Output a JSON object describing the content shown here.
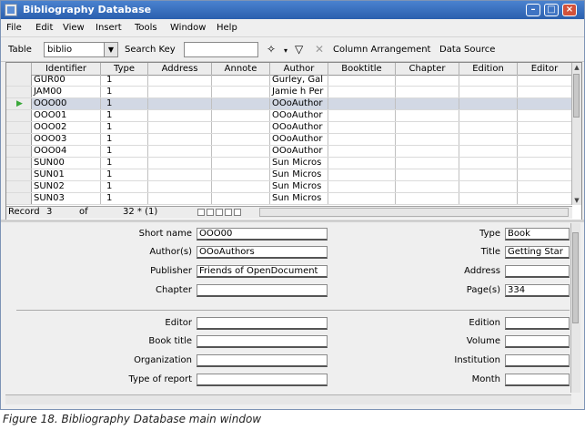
{
  "window": {
    "title": "Bibliography Database",
    "buttons": {
      "minimize": "–",
      "maximize": "□",
      "close": "×"
    }
  },
  "menu": [
    "File",
    "Edit",
    "View",
    "Insert",
    "Tools",
    "Window",
    "Help"
  ],
  "toolbar": {
    "table_label": "Table",
    "table_value": "biblio",
    "search_label": "Search Key",
    "search_value": "",
    "column_arrangement": "Column Arrangement",
    "data_source": "Data Source"
  },
  "table": {
    "columns": [
      "Identifier",
      "Type",
      "Address",
      "Annote",
      "Author",
      "Booktitle",
      "Chapter",
      "Edition",
      "Editor"
    ],
    "rows": [
      {
        "id": "GUR00",
        "type": "1",
        "author": "Gurley, Gal"
      },
      {
        "id": "JAM00",
        "type": "1",
        "author": "Jamie h Per"
      },
      {
        "id": "OOO00",
        "type": "1",
        "author": "OOoAuthor"
      },
      {
        "id": "OOO01",
        "type": "1",
        "author": "OOoAuthor"
      },
      {
        "id": "OOO02",
        "type": "1",
        "author": "OOoAuthor"
      },
      {
        "id": "OOO03",
        "type": "1",
        "author": "OOoAuthor"
      },
      {
        "id": "OOO04",
        "type": "1",
        "author": "OOoAuthor"
      },
      {
        "id": "SUN00",
        "type": "1",
        "author": "Sun Micros"
      },
      {
        "id": "SUN01",
        "type": "1",
        "author": "Sun Micros"
      },
      {
        "id": "SUN02",
        "type": "1",
        "author": "Sun Micros"
      },
      {
        "id": "SUN03",
        "type": "1",
        "author": "Sun Micros"
      }
    ],
    "selected_index": 2,
    "record_label": "Record",
    "record_number": "3",
    "of_label": "of",
    "record_total": "32 * (1)"
  },
  "form": {
    "left": [
      {
        "label": "Short name",
        "value": "OOO00"
      },
      {
        "label": "Author(s)",
        "value": "OOoAuthors"
      },
      {
        "label": "Publisher",
        "value": "Friends of OpenDocument"
      },
      {
        "label": "Chapter",
        "value": ""
      },
      {
        "label": "Editor",
        "value": ""
      },
      {
        "label": "Book title",
        "value": ""
      },
      {
        "label": "Organization",
        "value": ""
      },
      {
        "label": "Type of report",
        "value": ""
      }
    ],
    "right": [
      {
        "label": "Type",
        "value": "Book"
      },
      {
        "label": "Title",
        "value": "Getting Star"
      },
      {
        "label": "Address",
        "value": ""
      },
      {
        "label": "Page(s)",
        "value": "334"
      },
      {
        "label": "Edition",
        "value": ""
      },
      {
        "label": "Volume",
        "value": ""
      },
      {
        "label": "Institution",
        "value": ""
      },
      {
        "label": "Month",
        "value": ""
      }
    ]
  },
  "caption": "Figure 18. Bibliography Database main window"
}
